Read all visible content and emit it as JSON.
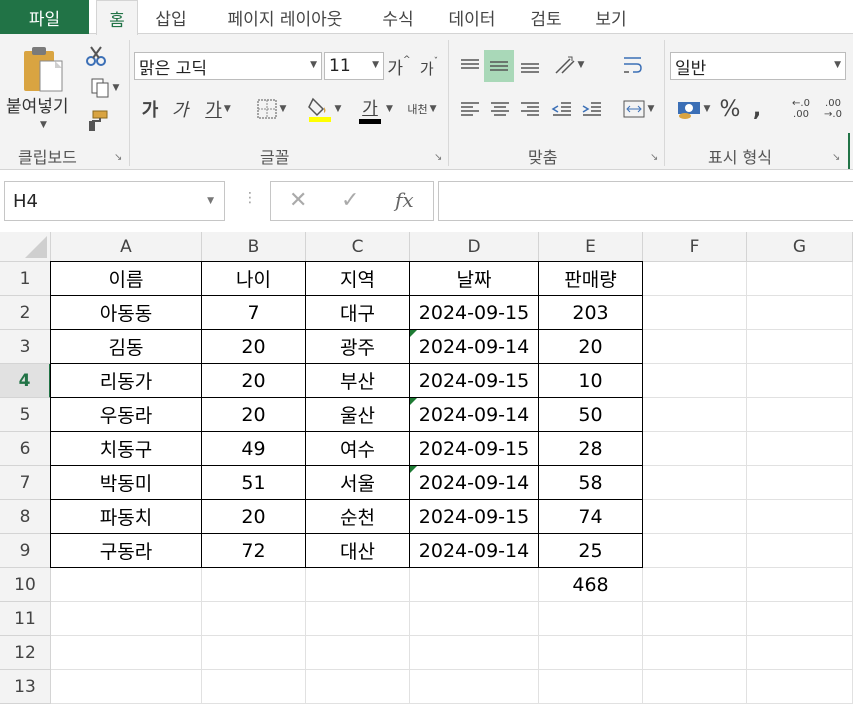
{
  "ribbon_tabs": {
    "file": "파일",
    "tabs": [
      "홈",
      "삽입",
      "페이지 레이아웃",
      "수식",
      "데이터",
      "검토",
      "보기"
    ]
  },
  "clipboard": {
    "paste_label": "붙여넣기",
    "group_label": "클립보드"
  },
  "font": {
    "name": "맑은 고딕",
    "size": "11",
    "grow_label": "가",
    "shrink_label": "가",
    "bold": "가",
    "italic": "가",
    "underline": "가",
    "font_color_label": "가",
    "phonetic_label": "내천",
    "group_label": "글꼴"
  },
  "alignment": {
    "group_label": "맞춤"
  },
  "number": {
    "format": "일반",
    "percent": "%",
    "comma": ",",
    "inc_decimal": "←.0 .00",
    "dec_decimal": ".00 →.0",
    "group_label": "표시 형식"
  },
  "formula_bar": {
    "name_box": "H4",
    "cancel": "✕",
    "enter": "✓",
    "fx": "fx",
    "formula": ""
  },
  "colors": {
    "accent": "#217346",
    "fill_swatch": "#ffff00",
    "font_swatch": "#000000"
  },
  "columns": [
    "A",
    "B",
    "C",
    "D",
    "E",
    "F",
    "G"
  ],
  "rows": [
    "1",
    "2",
    "3",
    "4",
    "5",
    "6",
    "7",
    "8",
    "9",
    "10",
    "11",
    "12",
    "13"
  ],
  "selected_row": "4",
  "sheet": {
    "header": [
      "이름",
      "나이",
      "지역",
      "날짜",
      "판매량"
    ],
    "data": [
      [
        "아동동",
        "7",
        "대구",
        "2024-09-15",
        "203"
      ],
      [
        "김동",
        "20",
        "광주",
        "2024-09-14",
        "20"
      ],
      [
        "리동가",
        "20",
        "부산",
        "2024-09-15",
        "10"
      ],
      [
        "우동라",
        "20",
        "울산",
        "2024-09-14",
        "50"
      ],
      [
        "치동구",
        "49",
        "여수",
        "2024-09-15",
        "28"
      ],
      [
        "박동미",
        "51",
        "서울",
        "2024-09-14",
        "58"
      ],
      [
        "파동치",
        "20",
        "순천",
        "2024-09-15",
        "74"
      ],
      [
        "구동라",
        "72",
        "대산",
        "2024-09-14",
        "25"
      ]
    ],
    "total": "468"
  }
}
